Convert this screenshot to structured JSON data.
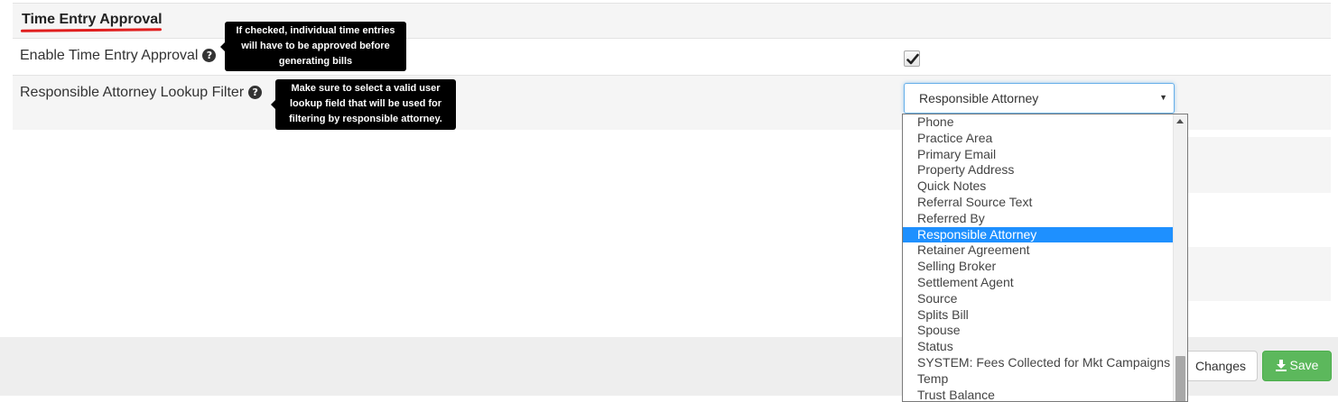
{
  "section": {
    "title": "Time Entry Approval"
  },
  "settings": {
    "enable_label": "Enable Time Entry Approval",
    "enable_tooltip": [
      "If checked, individual time entries",
      "will have to be approved before",
      "generating bills"
    ],
    "enable_checked": true,
    "lookup_label": "Responsible Attorney Lookup Filter",
    "lookup_tooltip": [
      "Make sure to select a valid user",
      "lookup field that will be used for",
      "filtering by responsible attorney."
    ],
    "lookup_value": "Responsible Attorney"
  },
  "help_icon_glyph": "?",
  "dropdown": {
    "items": [
      "Phone",
      "Practice Area",
      "Primary Email",
      "Property Address",
      "Quick Notes",
      "Referral Source Text",
      "Referred By",
      "Responsible Attorney",
      "Retainer Agreement",
      "Selling Broker",
      "Settlement Agent",
      "Source",
      "Splits Bill",
      "Spouse",
      "Status",
      "SYSTEM: Fees Collected for Mkt Campaigns",
      "Temp",
      "Trust Balance"
    ],
    "selected": "Responsible Attorney"
  },
  "footer": {
    "changes_label": "Changes",
    "save_label": "Save"
  },
  "colors": {
    "save_button": "#5cb85c",
    "selected_item": "#1e90ff",
    "title_underline": "#e01e1e"
  },
  "icons": [
    "question-circle-icon",
    "check-icon",
    "download-icon",
    "dropdown-arrow-icon",
    "scroll-up-arrow-icon"
  ]
}
